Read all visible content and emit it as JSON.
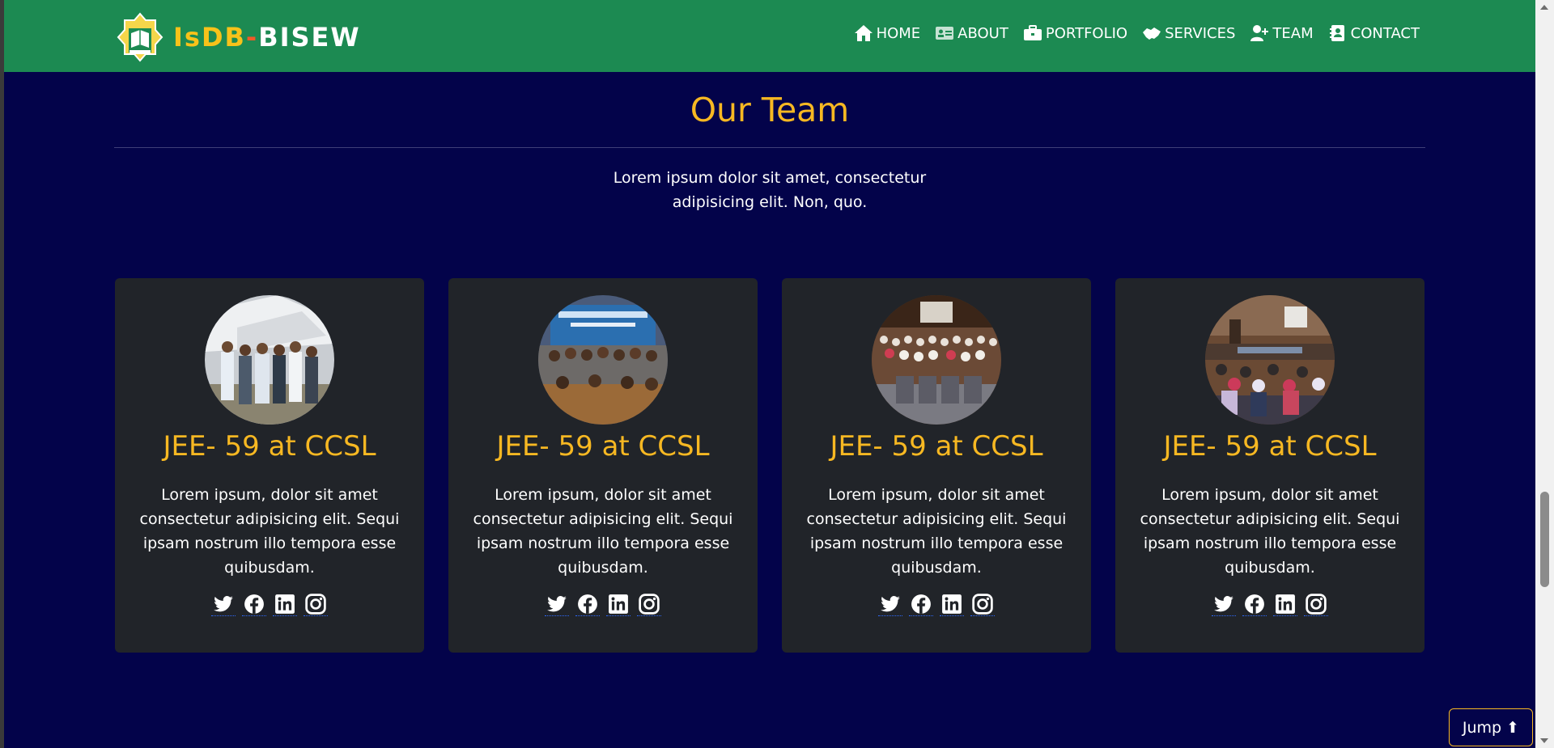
{
  "brand": {
    "part1": "IsDB",
    "dash": "-",
    "part2": "BISEW",
    "logo_label": "IsDB-BISEW"
  },
  "nav": [
    {
      "label": "HOME",
      "icon": "home-icon"
    },
    {
      "label": "ABOUT",
      "icon": "id-card-icon"
    },
    {
      "label": "PORTFOLIO",
      "icon": "briefcase-icon"
    },
    {
      "label": "SERVICES",
      "icon": "handshake-icon"
    },
    {
      "label": "TEAM",
      "icon": "user-plus-icon"
    },
    {
      "label": "CONTACT",
      "icon": "address-book-icon"
    }
  ],
  "section": {
    "title": "Our Team",
    "subtitle": "Lorem ipsum dolor sit amet, consectetur adipisicing elit. Non, quo."
  },
  "cards": [
    {
      "title": "JEE- 59 at CCSL",
      "text": "Lorem ipsum, dolor sit amet consectetur adipisicing elit. Sequi ipsam nostrum illo tempora esse quibusdam."
    },
    {
      "title": "JEE- 59 at CCSL",
      "text": "Lorem ipsum, dolor sit amet consectetur adipisicing elit. Sequi ipsam nostrum illo tempora esse quibusdam."
    },
    {
      "title": "JEE- 59 at CCSL",
      "text": "Lorem ipsum, dolor sit amet consectetur adipisicing elit. Sequi ipsam nostrum illo tempora esse quibusdam."
    },
    {
      "title": "JEE- 59 at CCSL",
      "text": "Lorem ipsum, dolor sit amet consectetur adipisicing elit. Sequi ipsam nostrum illo tempora esse quibusdam."
    }
  ],
  "jump": {
    "label": "Jump ⬆"
  },
  "colors": {
    "navbar": "#1c8a52",
    "page": "#03034a",
    "card": "#212429",
    "accent": "#f7b822"
  }
}
